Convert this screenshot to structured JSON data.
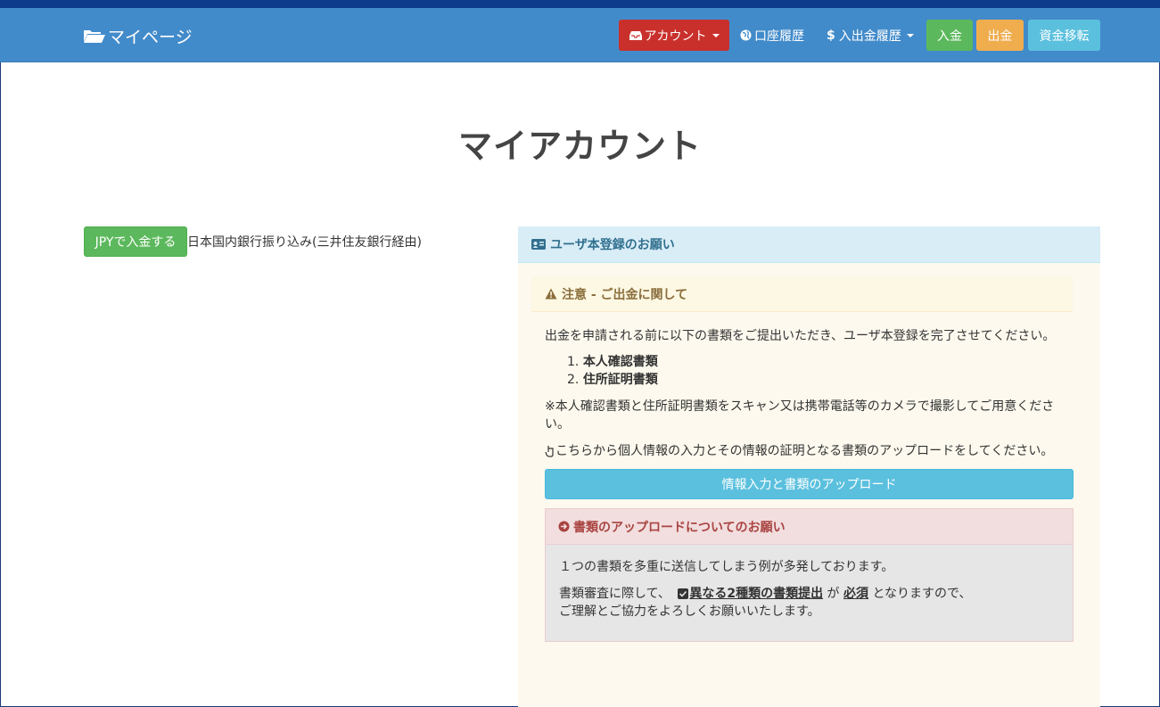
{
  "navbar": {
    "brand": "マイページ",
    "account_label": "アカウント",
    "history_label": "口座履歴",
    "deposit_history_label": "入出金履歴",
    "deposit_label": "入金",
    "withdraw_label": "出金",
    "transfer_label": "資金移転"
  },
  "main": {
    "title": "マイアカウント",
    "jpy_button": "JPYで入金する",
    "jpy_text": "日本国内銀行振り込み(三井住友銀行経由)"
  },
  "panel": {
    "heading": "ユーザ本登録のお願い",
    "warning_title": "注意 - ご出金に関して",
    "intro": "出金を申請される前に以下の書類をご提出いただき、ユーザ本登録を完了させてください。",
    "docs": [
      {
        "num": "1.",
        "label": "本人確認書類"
      },
      {
        "num": "2.",
        "label": "住所証明書類"
      }
    ],
    "note": "※本人確認書類と住所証明書類をスキャン又は携帯電話等のカメラで撮影してご用意ください。",
    "upload_hint": "こちらから個人情報の入力とその情報の証明となる書類のアップロードをしてください。",
    "upload_button": "情報入力と書類のアップロード",
    "danger": {
      "title": "書類のアップロードについてのお願い",
      "line1": "１つの書類を多重に送信してしまう例が多発しております。",
      "line2_prefix": "書類審査に際して、",
      "line2_bold": "異なる2種類の書類提出",
      "line2_mid": "が",
      "line2_bold2": "必須",
      "line2_suffix": "となりますので、",
      "line3": "ご理解とご協力をよろしくお願いいたします。"
    }
  },
  "colors": {
    "navbar": "#428bca",
    "account_btn": "#c9302c",
    "success": "#5cb85c",
    "warning": "#f0ad4e",
    "info": "#5bc0de"
  }
}
